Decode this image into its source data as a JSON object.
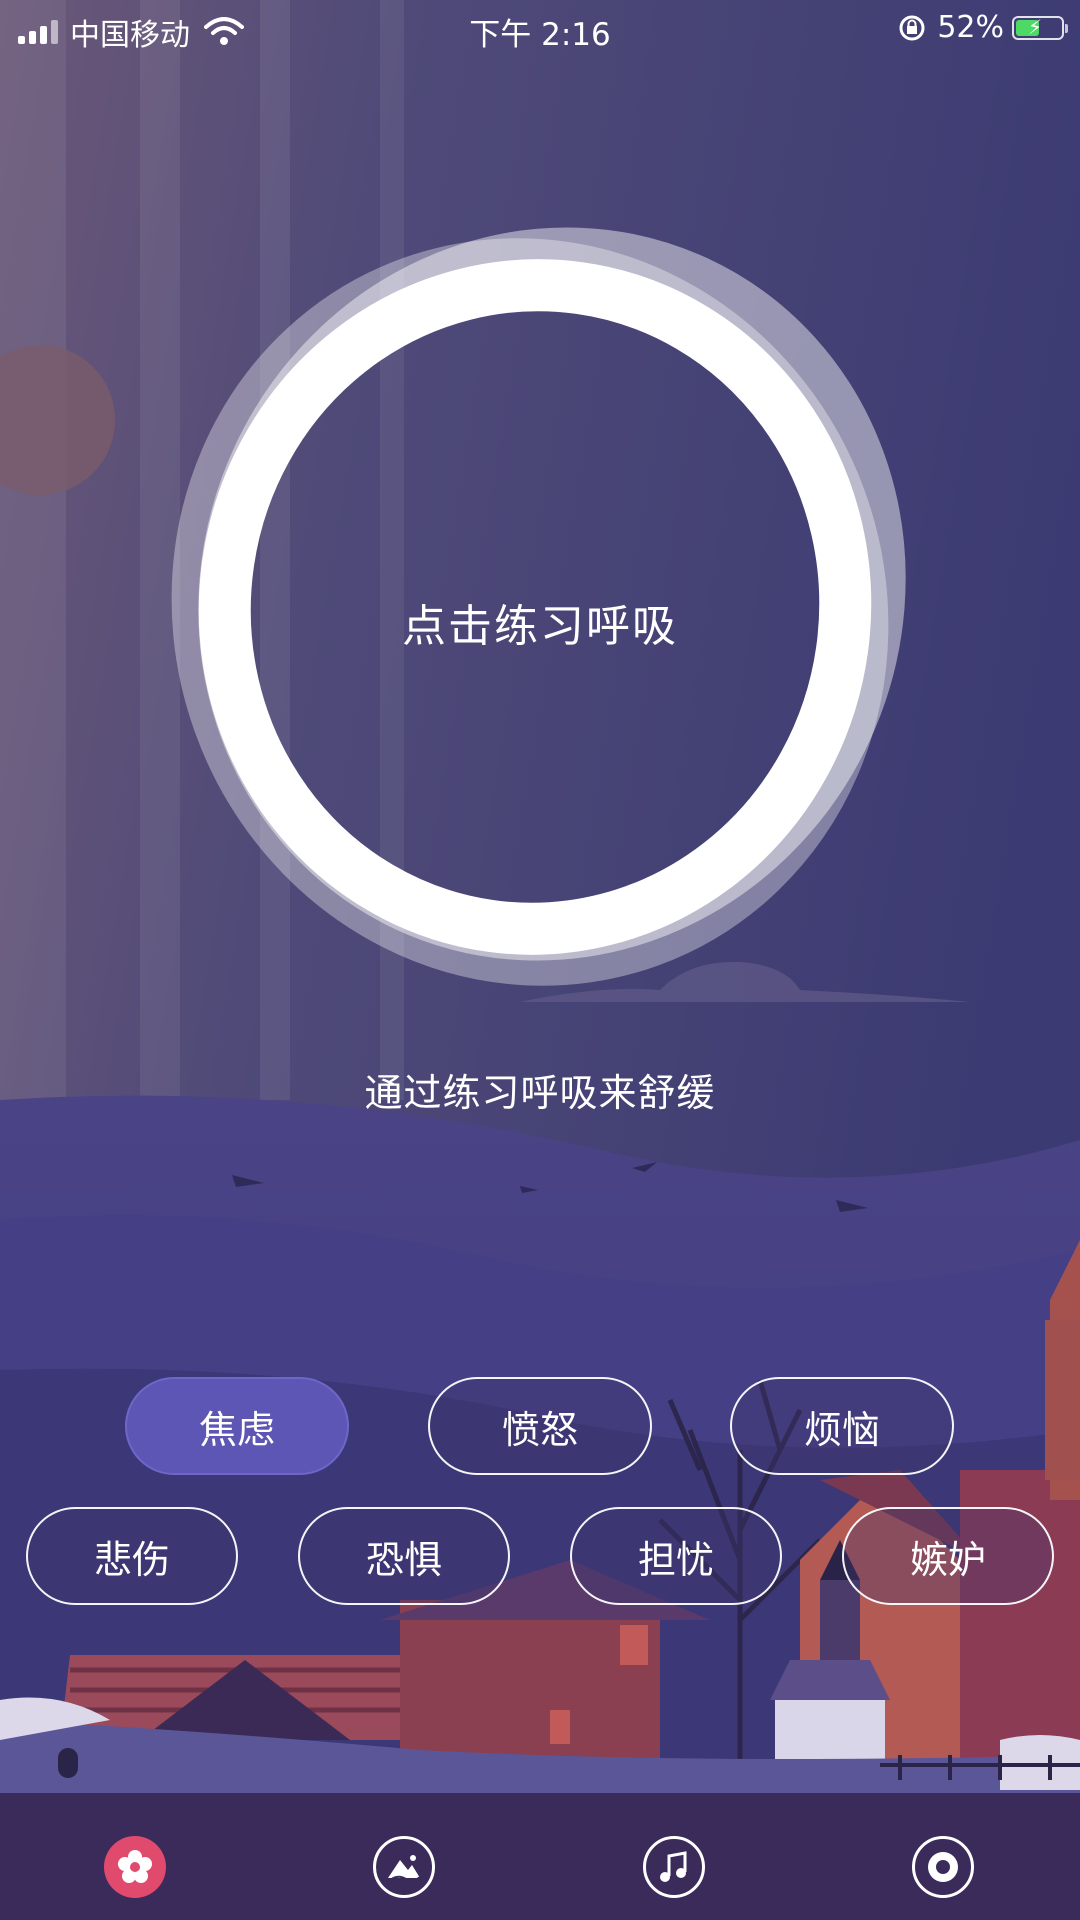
{
  "status_bar": {
    "carrier": "中国移动",
    "time": "下午 2:16",
    "battery_percent": "52%",
    "battery_level": 0.52,
    "icons": [
      "signal-icon",
      "wifi-icon",
      "orientation-lock-icon",
      "battery-icon"
    ]
  },
  "breath": {
    "prompt": "点击练习呼吸",
    "subtitle": "通过练习呼吸来舒缓"
  },
  "moods": {
    "selected": "焦虑",
    "row1": [
      "焦虑",
      "愤怒",
      "烦恼"
    ],
    "row2": [
      "悲伤",
      "恐惧",
      "担忧",
      "嫉妒"
    ]
  },
  "tabbar": {
    "items": [
      {
        "icon": "flower-icon",
        "active": true
      },
      {
        "icon": "landscape-icon",
        "active": false
      },
      {
        "icon": "music-note-icon",
        "active": false
      },
      {
        "icon": "record-icon",
        "active": false
      }
    ],
    "active_color": "#e04a6d"
  },
  "colors": {
    "background": "#3f3c6e",
    "accent": "#5e56b5",
    "tabbar": "#3a2b5a"
  }
}
